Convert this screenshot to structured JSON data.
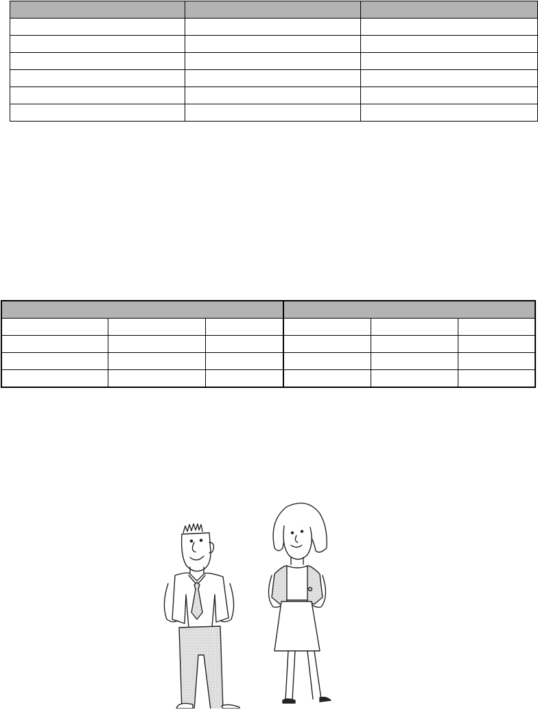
{
  "table_1": {
    "headers": [
      "",
      "",
      ""
    ],
    "rows": [
      [
        "",
        "",
        ""
      ],
      [
        "",
        "",
        ""
      ],
      [
        "",
        "",
        ""
      ],
      [
        "",
        "",
        ""
      ],
      [
        "",
        "",
        ""
      ],
      [
        "",
        "",
        ""
      ]
    ]
  },
  "table_2": {
    "group_headers": [
      "",
      ""
    ],
    "rows": [
      [
        "",
        "",
        "",
        "",
        "",
        ""
      ],
      [
        "",
        "",
        "",
        "",
        "",
        ""
      ],
      [
        "",
        "",
        "",
        "",
        "",
        ""
      ],
      [
        "",
        "",
        "",
        "",
        "",
        ""
      ]
    ]
  },
  "illustration": {
    "icons": [
      "businessman-clipart-icon",
      "businesswoman-clipart-icon"
    ]
  }
}
